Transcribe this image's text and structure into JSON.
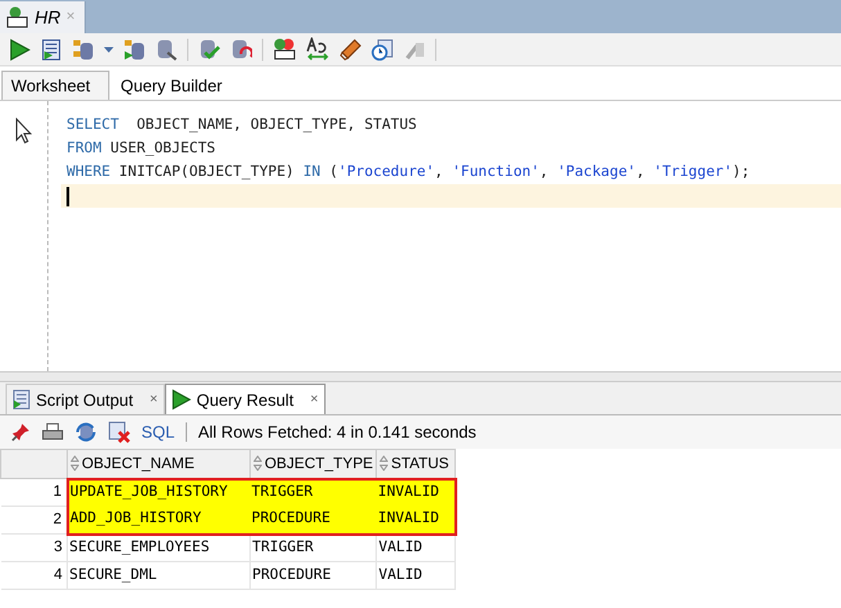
{
  "document_tab": {
    "title": "HR",
    "close": "×"
  },
  "editor_tabs": [
    {
      "label": "Worksheet",
      "selected": true
    },
    {
      "label": "Query Builder",
      "selected": false
    }
  ],
  "editor": {
    "lines": [
      {
        "current": false,
        "segments": [
          {
            "text": "SELECT",
            "kind": "keyword"
          },
          {
            "text": "  OBJECT_NAME, OBJECT_TYPE, STATUS",
            "kind": "plain"
          }
        ]
      },
      {
        "current": false,
        "segments": [
          {
            "text": "FROM",
            "kind": "keyword"
          },
          {
            "text": " USER_OBJECTS",
            "kind": "plain"
          }
        ]
      },
      {
        "current": false,
        "segments": [
          {
            "text": "WHERE",
            "kind": "keyword"
          },
          {
            "text": " INITCAP(OBJECT_TYPE) ",
            "kind": "plain"
          },
          {
            "text": "IN",
            "kind": "keyword"
          },
          {
            "text": " (",
            "kind": "plain"
          },
          {
            "text": "'Procedure'",
            "kind": "string"
          },
          {
            "text": ", ",
            "kind": "plain"
          },
          {
            "text": "'Function'",
            "kind": "string"
          },
          {
            "text": ", ",
            "kind": "plain"
          },
          {
            "text": "'Package'",
            "kind": "string"
          },
          {
            "text": ", ",
            "kind": "plain"
          },
          {
            "text": "'Trigger'",
            "kind": "string"
          },
          {
            "text": ");",
            "kind": "plain"
          }
        ]
      },
      {
        "current": true
      }
    ]
  },
  "result_tabs": [
    {
      "label": "Script Output",
      "close": "×",
      "selected": false,
      "kind": "script"
    },
    {
      "label": "Query Result",
      "close": "×",
      "selected": true,
      "kind": "query"
    }
  ],
  "result_toolbar": {
    "sql_link": "SQL",
    "status": "All Rows Fetched: 4 in 0.141 seconds"
  },
  "table": {
    "columns": [
      "OBJECT_NAME",
      "OBJECT_TYPE",
      "STATUS"
    ],
    "rows": [
      {
        "number": "1",
        "cells": [
          "UPDATE_JOB_HISTORY",
          "TRIGGER",
          "INVALID"
        ],
        "highlighted": true
      },
      {
        "number": "2",
        "cells": [
          "ADD_JOB_HISTORY",
          "PROCEDURE",
          "INVALID"
        ],
        "highlighted": true
      },
      {
        "number": "3",
        "cells": [
          "SECURE_EMPLOYEES",
          "TRIGGER",
          "VALID"
        ],
        "highlighted": false
      },
      {
        "number": "4",
        "cells": [
          "SECURE_DML",
          "PROCEDURE",
          "VALID"
        ],
        "highlighted": false
      }
    ]
  }
}
